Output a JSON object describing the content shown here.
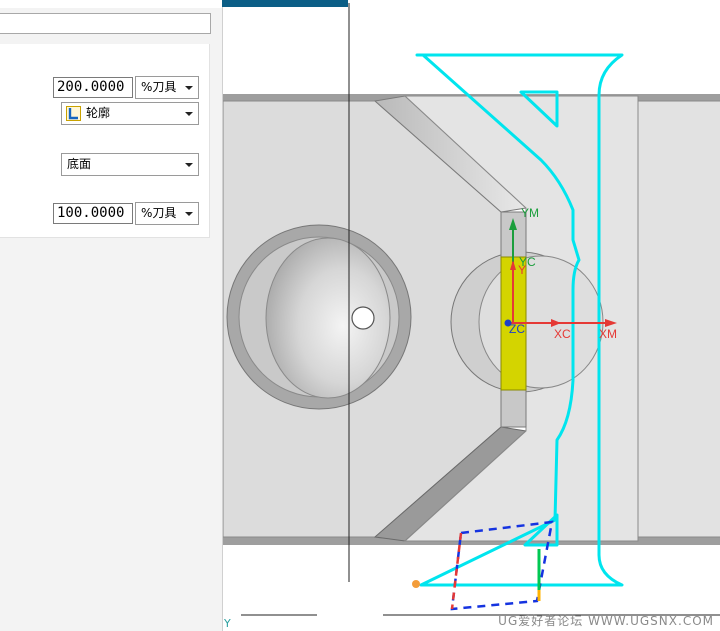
{
  "dialog": {
    "field1_value": "200.0000",
    "field1_unit": "%刀具",
    "pattern_combo": "轮廓",
    "pattern_icon": "contour-pattern-icon",
    "stock_combo": "底面",
    "field2_value": "100.0000",
    "field2_unit": "%刀具"
  },
  "viewport": {
    "axis_labels": {
      "ym": "YM",
      "yc": "YC",
      "y": "Y",
      "zc": "ZC",
      "xc": "XC",
      "xm": "XM"
    },
    "corner_label": "Y",
    "watermark": "UG爱好者论坛 WWW.UGSNX.COM",
    "colors": {
      "tool_path": "#00e5ee",
      "selected_face": "#d4d400",
      "axis_x": "#e53935",
      "axis_y": "#1b9e3c",
      "axis_z": "#1e3fc8",
      "part_body": "#dcdcdc",
      "titlebar": "#0b5e86"
    }
  }
}
